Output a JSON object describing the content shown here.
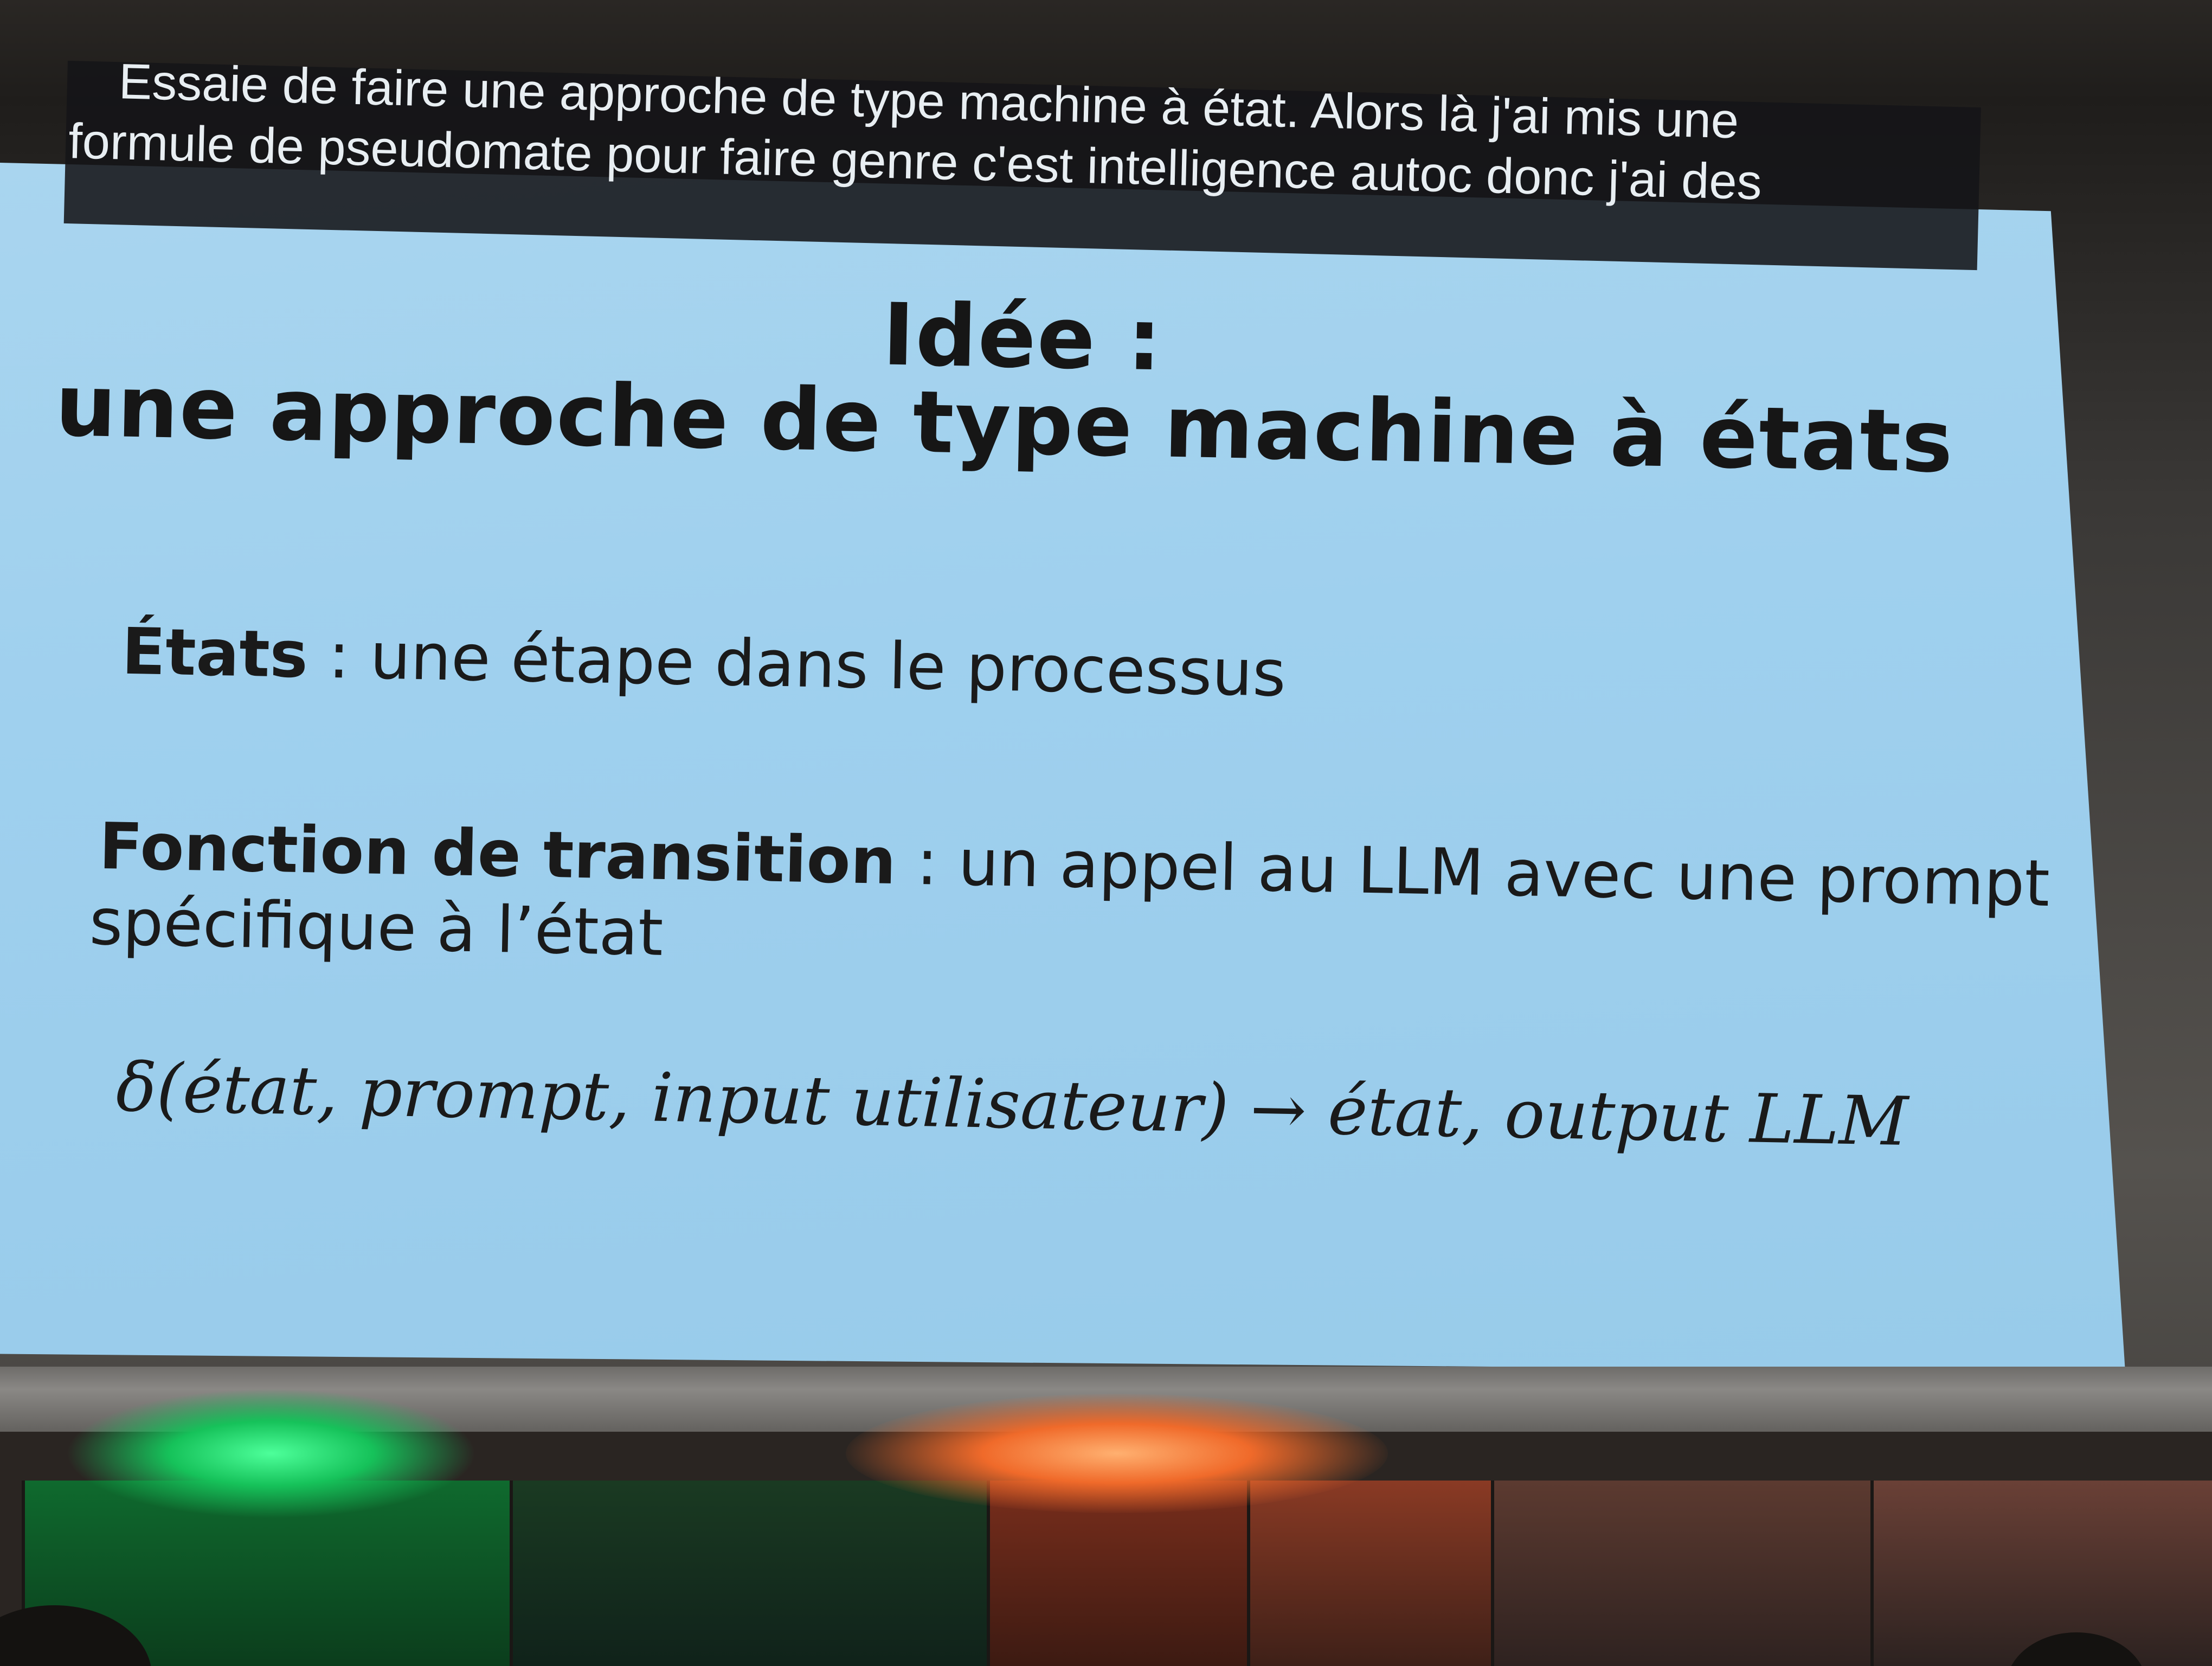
{
  "caption": {
    "line1": "Essaie de faire une approche de type machine à état. Alors là j'ai mis une",
    "line2": "formule de pseudomate pour faire genre c'est intelligence autoc donc j'ai des"
  },
  "slide": {
    "title_line1": "Idée :",
    "title_line2": "une approche de type machine à états",
    "items": [
      {
        "term": "États",
        "separator": " : ",
        "text": "une étape dans le processus"
      },
      {
        "term": "Fonction de transition",
        "separator": " : ",
        "text": "un appel au LLM avec une prompt",
        "continuation": "spécifique à l’état"
      }
    ],
    "formula": "δ(état, prompt, input utilisateur) → état, output LLM"
  },
  "colors": {
    "slide_background": "#a3d2ee",
    "slide_text": "#161616",
    "caption_background": "#141418",
    "caption_text": "#e8eef2",
    "stage_light_left": "#16c25a",
    "stage_light_right": "#f06a2a"
  }
}
